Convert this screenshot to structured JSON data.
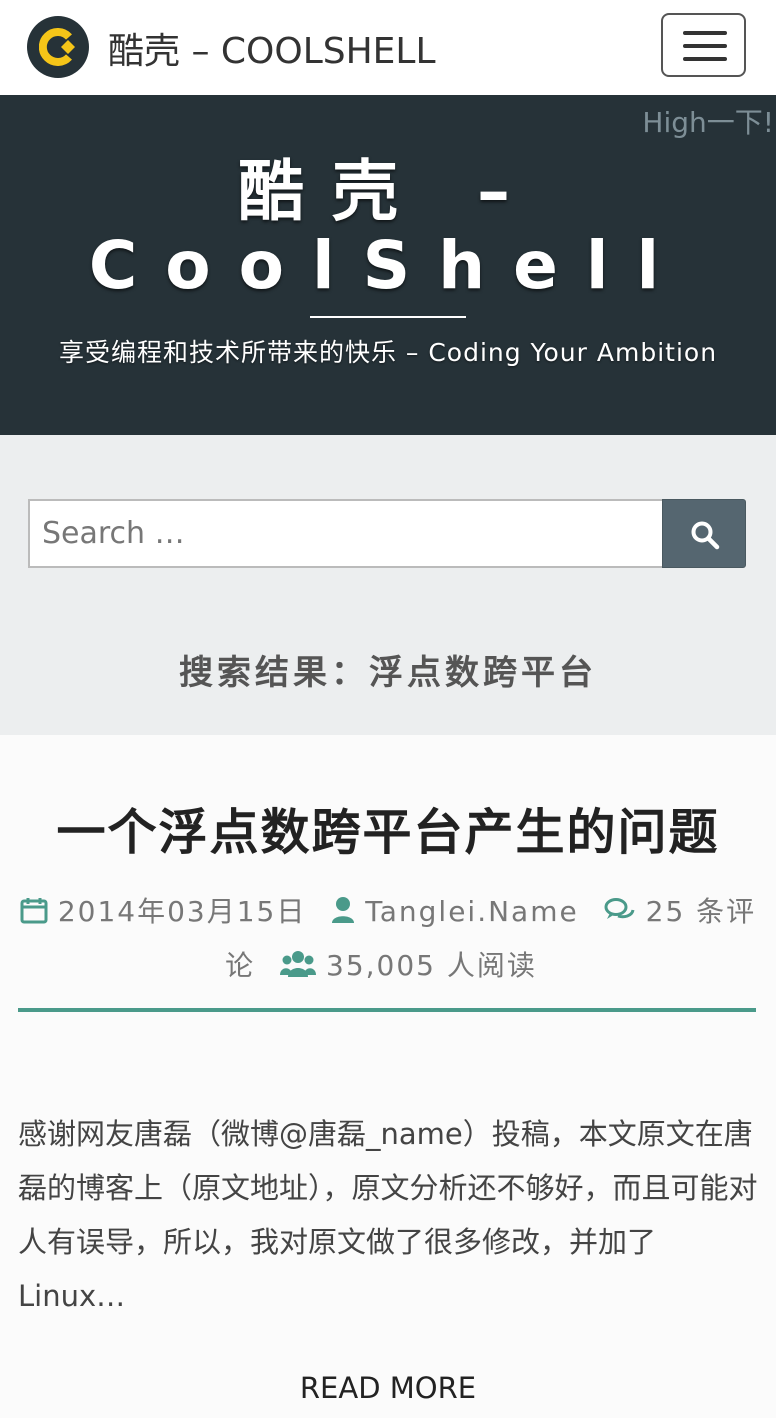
{
  "colors": {
    "hero_bg": "#263238",
    "accent": "#4a9a8a",
    "logo_yellow": "#f5c518",
    "search_button": "#556670"
  },
  "nav": {
    "brand": "酷壳 – COOLSHELL",
    "logo_icon": "coolshell-logo-icon",
    "menu_icon": "hamburger-menu-icon"
  },
  "hero": {
    "high_link": "High一下!",
    "site_title": "酷壳 – CoolShell",
    "tagline": "享受编程和技术所带来的快乐 – Coding Your Ambition"
  },
  "search": {
    "placeholder": "Search …",
    "button_icon": "search-icon",
    "heading": "搜索结果：浮点数跨平台"
  },
  "post": {
    "title": "一个浮点数跨平台产生的问题",
    "date": "2014年03月15日",
    "author": "Tanglei.Name",
    "comments": "25 条评论",
    "views": "35,005 人阅读",
    "excerpt": "感谢网友唐磊（微博@唐磊_name）投稿，本文原文在唐磊的博客上（原文地址），原文分析还不够好，而且可能对人有误导，所以，我对原文做了很多修改，并加了Linux…",
    "read_more": "READ MORE"
  }
}
